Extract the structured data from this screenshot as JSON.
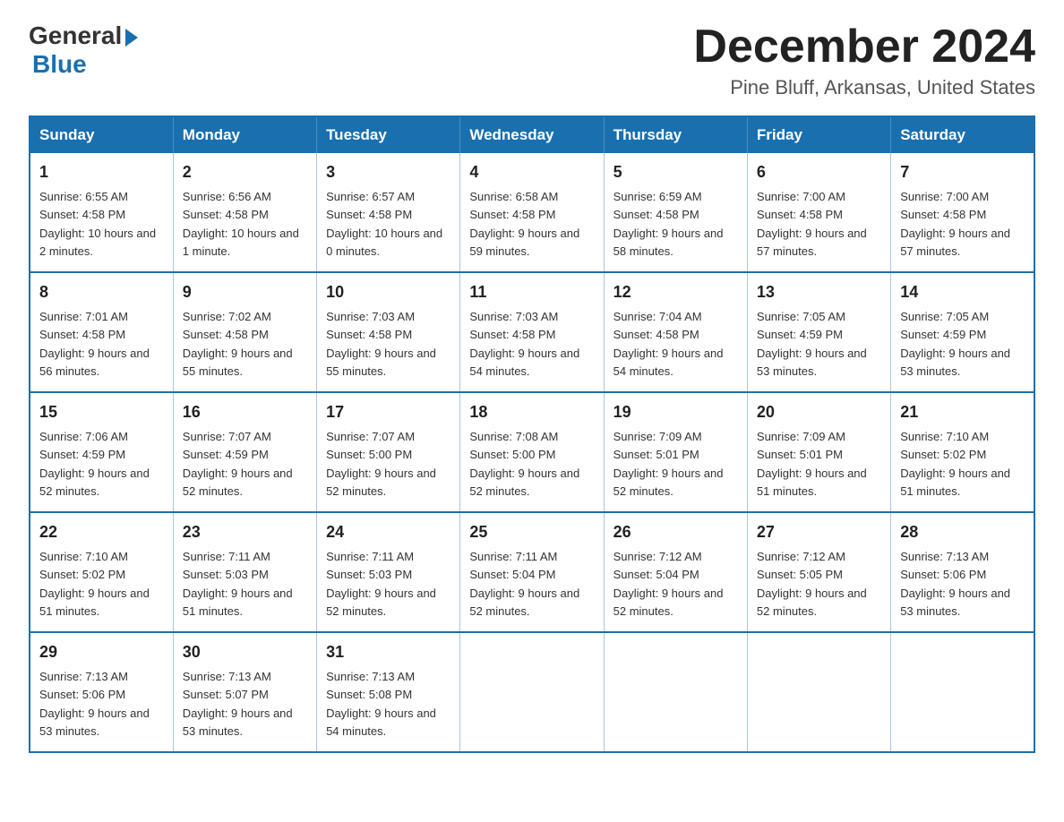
{
  "logo": {
    "general": "General",
    "blue": "Blue"
  },
  "header": {
    "month": "December 2024",
    "location": "Pine Bluff, Arkansas, United States"
  },
  "weekdays": [
    "Sunday",
    "Monday",
    "Tuesday",
    "Wednesday",
    "Thursday",
    "Friday",
    "Saturday"
  ],
  "weeks": [
    [
      {
        "day": "1",
        "sunrise": "6:55 AM",
        "sunset": "4:58 PM",
        "daylight": "10 hours and 2 minutes."
      },
      {
        "day": "2",
        "sunrise": "6:56 AM",
        "sunset": "4:58 PM",
        "daylight": "10 hours and 1 minute."
      },
      {
        "day": "3",
        "sunrise": "6:57 AM",
        "sunset": "4:58 PM",
        "daylight": "10 hours and 0 minutes."
      },
      {
        "day": "4",
        "sunrise": "6:58 AM",
        "sunset": "4:58 PM",
        "daylight": "9 hours and 59 minutes."
      },
      {
        "day": "5",
        "sunrise": "6:59 AM",
        "sunset": "4:58 PM",
        "daylight": "9 hours and 58 minutes."
      },
      {
        "day": "6",
        "sunrise": "7:00 AM",
        "sunset": "4:58 PM",
        "daylight": "9 hours and 57 minutes."
      },
      {
        "day": "7",
        "sunrise": "7:00 AM",
        "sunset": "4:58 PM",
        "daylight": "9 hours and 57 minutes."
      }
    ],
    [
      {
        "day": "8",
        "sunrise": "7:01 AM",
        "sunset": "4:58 PM",
        "daylight": "9 hours and 56 minutes."
      },
      {
        "day": "9",
        "sunrise": "7:02 AM",
        "sunset": "4:58 PM",
        "daylight": "9 hours and 55 minutes."
      },
      {
        "day": "10",
        "sunrise": "7:03 AM",
        "sunset": "4:58 PM",
        "daylight": "9 hours and 55 minutes."
      },
      {
        "day": "11",
        "sunrise": "7:03 AM",
        "sunset": "4:58 PM",
        "daylight": "9 hours and 54 minutes."
      },
      {
        "day": "12",
        "sunrise": "7:04 AM",
        "sunset": "4:58 PM",
        "daylight": "9 hours and 54 minutes."
      },
      {
        "day": "13",
        "sunrise": "7:05 AM",
        "sunset": "4:59 PM",
        "daylight": "9 hours and 53 minutes."
      },
      {
        "day": "14",
        "sunrise": "7:05 AM",
        "sunset": "4:59 PM",
        "daylight": "9 hours and 53 minutes."
      }
    ],
    [
      {
        "day": "15",
        "sunrise": "7:06 AM",
        "sunset": "4:59 PM",
        "daylight": "9 hours and 52 minutes."
      },
      {
        "day": "16",
        "sunrise": "7:07 AM",
        "sunset": "4:59 PM",
        "daylight": "9 hours and 52 minutes."
      },
      {
        "day": "17",
        "sunrise": "7:07 AM",
        "sunset": "5:00 PM",
        "daylight": "9 hours and 52 minutes."
      },
      {
        "day": "18",
        "sunrise": "7:08 AM",
        "sunset": "5:00 PM",
        "daylight": "9 hours and 52 minutes."
      },
      {
        "day": "19",
        "sunrise": "7:09 AM",
        "sunset": "5:01 PM",
        "daylight": "9 hours and 52 minutes."
      },
      {
        "day": "20",
        "sunrise": "7:09 AM",
        "sunset": "5:01 PM",
        "daylight": "9 hours and 51 minutes."
      },
      {
        "day": "21",
        "sunrise": "7:10 AM",
        "sunset": "5:02 PM",
        "daylight": "9 hours and 51 minutes."
      }
    ],
    [
      {
        "day": "22",
        "sunrise": "7:10 AM",
        "sunset": "5:02 PM",
        "daylight": "9 hours and 51 minutes."
      },
      {
        "day": "23",
        "sunrise": "7:11 AM",
        "sunset": "5:03 PM",
        "daylight": "9 hours and 51 minutes."
      },
      {
        "day": "24",
        "sunrise": "7:11 AM",
        "sunset": "5:03 PM",
        "daylight": "9 hours and 52 minutes."
      },
      {
        "day": "25",
        "sunrise": "7:11 AM",
        "sunset": "5:04 PM",
        "daylight": "9 hours and 52 minutes."
      },
      {
        "day": "26",
        "sunrise": "7:12 AM",
        "sunset": "5:04 PM",
        "daylight": "9 hours and 52 minutes."
      },
      {
        "day": "27",
        "sunrise": "7:12 AM",
        "sunset": "5:05 PM",
        "daylight": "9 hours and 52 minutes."
      },
      {
        "day": "28",
        "sunrise": "7:13 AM",
        "sunset": "5:06 PM",
        "daylight": "9 hours and 53 minutes."
      }
    ],
    [
      {
        "day": "29",
        "sunrise": "7:13 AM",
        "sunset": "5:06 PM",
        "daylight": "9 hours and 53 minutes."
      },
      {
        "day": "30",
        "sunrise": "7:13 AM",
        "sunset": "5:07 PM",
        "daylight": "9 hours and 53 minutes."
      },
      {
        "day": "31",
        "sunrise": "7:13 AM",
        "sunset": "5:08 PM",
        "daylight": "9 hours and 54 minutes."
      },
      null,
      null,
      null,
      null
    ]
  ],
  "labels": {
    "sunrise": "Sunrise:",
    "sunset": "Sunset:",
    "daylight": "Daylight:"
  }
}
